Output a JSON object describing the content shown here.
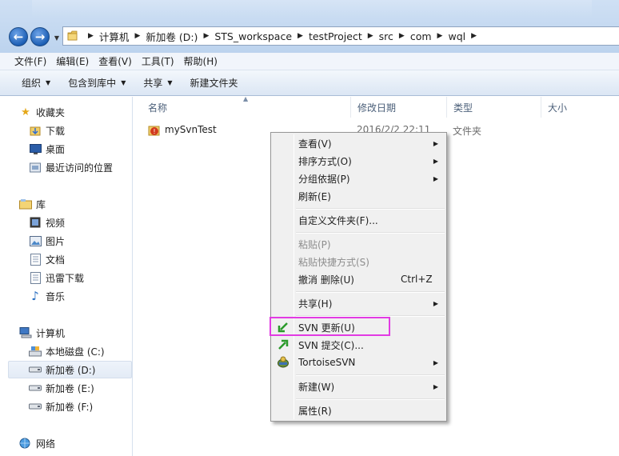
{
  "address_bar": {
    "crumbs": [
      "计算机",
      "新加卷 (D:)",
      "STS_workspace",
      "testProject",
      "src",
      "com",
      "wql"
    ]
  },
  "menu_bar": [
    "文件(F)",
    "编辑(E)",
    "查看(V)",
    "工具(T)",
    "帮助(H)"
  ],
  "toolbar": {
    "organize": "组织",
    "include_in_library": "包含到库中",
    "share": "共享",
    "new_folder": "新建文件夹"
  },
  "nav_pane": {
    "favorites": {
      "header": "收藏夹",
      "items": [
        "下载",
        "桌面",
        "最近访问的位置"
      ]
    },
    "libraries": {
      "header": "库",
      "items": [
        "视频",
        "图片",
        "文档",
        "迅雷下载",
        "音乐"
      ]
    },
    "computer": {
      "header": "计算机",
      "items": [
        "本地磁盘 (C:)",
        "新加卷 (D:)",
        "新加卷 (E:)",
        "新加卷 (F:)"
      ],
      "selected": "新加卷 (D:)"
    },
    "network": {
      "header": "网络"
    }
  },
  "columns": [
    "名称",
    "修改日期",
    "类型",
    "大小"
  ],
  "files": [
    {
      "name": "mySvnTest",
      "date": "2016/2/2 22:11",
      "type": "文件夹"
    }
  ],
  "context_menu": {
    "view": "查看(V)",
    "sort_by": "排序方式(O)",
    "group_by": "分组依据(P)",
    "refresh": "刷新(E)",
    "customize_folder": "自定义文件夹(F)...",
    "paste": "粘贴(P)",
    "paste_shortcut": "粘贴快捷方式(S)",
    "undo_delete": "撤消 删除(U)",
    "undo_shortcut": "Ctrl+Z",
    "share": "共享(H)",
    "svn_update": "SVN 更新(U)",
    "svn_commit": "SVN 提交(C)...",
    "tortoise_svn": "TortoiseSVN",
    "new": "新建(W)",
    "properties": "属性(R)"
  },
  "colors": {
    "highlight_box": "#e23be3",
    "selection": "#e3ebf6"
  }
}
